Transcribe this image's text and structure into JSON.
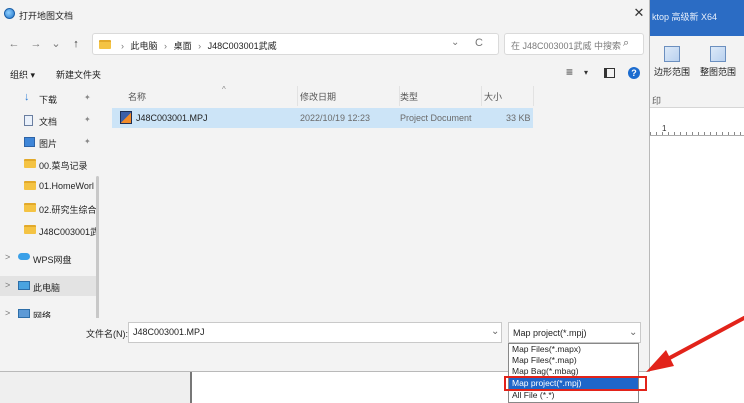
{
  "background_app": {
    "title_fragment": "ktop 高级新 X64",
    "ribbon": {
      "btn1": "边形范围",
      "btn2": "整图范围",
      "group_label": "印"
    },
    "ruler_label": "1"
  },
  "dialog": {
    "title": "打开地图文档",
    "close": "✕"
  },
  "nav": {
    "back": "←",
    "forward": "→",
    "recent": "⌄",
    "up": "↑",
    "breadcrumb": [
      "此电脑",
      "桌面",
      "J48C003001武威"
    ],
    "dropdown": "⌄",
    "refresh": "C",
    "search_placeholder": "在 J48C003001武威 中搜索",
    "search_icon": "⌕"
  },
  "toolbar": {
    "organize": "组织 ▾",
    "new_folder": "新建文件夹",
    "view": "≡",
    "view_drop": "▾",
    "help": "?"
  },
  "sidebar": {
    "items": [
      {
        "label": "下载",
        "icon": "download-icon",
        "pinned": true
      },
      {
        "label": "文档",
        "icon": "document-icon",
        "pinned": true
      },
      {
        "label": "图片",
        "icon": "pictures-icon",
        "pinned": true
      },
      {
        "label": "00.菜鸟记录",
        "icon": "folder-icon"
      },
      {
        "label": "01.HomeWorl",
        "icon": "folder-icon"
      },
      {
        "label": "02.研究生综合",
        "icon": "folder-icon"
      },
      {
        "label": "J48C003001武",
        "icon": "folder-icon"
      },
      {
        "label": "WPS网盘",
        "icon": "cloud-icon"
      },
      {
        "label": "此电脑",
        "icon": "computer-icon"
      },
      {
        "label": "网络",
        "icon": "network-icon"
      }
    ],
    "pin_glyph": "✦",
    "chevron": ">"
  },
  "filelist": {
    "columns": {
      "name": "名称",
      "modified": "修改日期",
      "type": "类型",
      "size": "大小"
    },
    "sort_arrow": "^",
    "rows": [
      {
        "name": "J48C003001.MPJ",
        "modified": "2022/10/19 12:23",
        "type": "Project Document",
        "size": "33 KB"
      }
    ]
  },
  "bottom": {
    "filename_label": "文件名(N):",
    "filename_value": "J48C003001.MPJ",
    "filename_drop": "⌄",
    "filetype_selected": "Map project(*.mpj)",
    "filetype_drop": "⌄",
    "filetype_options": [
      "Map Files(*.mapx)",
      "Map Files(*.map)",
      "Map Bag(*.mbag)",
      "Map project(*.mpj)",
      "All File (*.*)"
    ],
    "highlighted_index": 3
  },
  "colors": {
    "selection": "#cce4f7",
    "highlight": "#1f66c9",
    "annotation": "#e2231a"
  }
}
